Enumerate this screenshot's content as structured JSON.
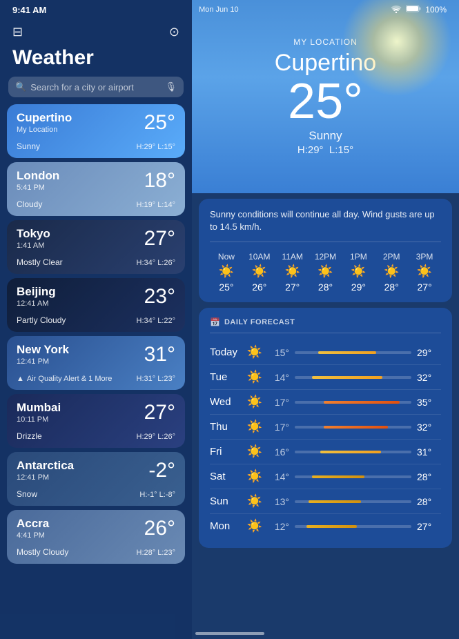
{
  "statusBar": {
    "time": "9:41 AM",
    "date": "Mon Jun 10",
    "wifi": "100%"
  },
  "leftPanel": {
    "title": "Weather",
    "search": {
      "placeholder": "Search for a city or airport"
    },
    "cities": [
      {
        "name": "Cupertino",
        "sublabel": "My Location",
        "time": "",
        "temp": "25°",
        "condition": "Sunny",
        "high": "H:29°",
        "low": "L:15°",
        "style": "sunny",
        "alert": false
      },
      {
        "name": "London",
        "sublabel": "",
        "time": "5:41 PM",
        "temp": "18°",
        "condition": "Cloudy",
        "high": "H:19°",
        "low": "L:14°",
        "style": "cloudy",
        "alert": false
      },
      {
        "name": "Tokyo",
        "sublabel": "",
        "time": "1:41 AM",
        "temp": "27°",
        "condition": "Mostly Clear",
        "high": "H:34°",
        "low": "L:26°",
        "style": "night",
        "alert": false
      },
      {
        "name": "Beijing",
        "sublabel": "",
        "time": "12:41 AM",
        "temp": "23°",
        "condition": "Partly Cloudy",
        "high": "H:34°",
        "low": "L:22°",
        "style": "night2",
        "alert": false
      },
      {
        "name": "New York",
        "sublabel": "",
        "time": "12:41 PM",
        "temp": "31°",
        "condition": "Air Quality Alert & 1 More",
        "high": "H:31°",
        "low": "L:23°",
        "style": "alert",
        "alert": true
      },
      {
        "name": "Mumbai",
        "sublabel": "",
        "time": "10:11 PM",
        "temp": "27°",
        "condition": "Drizzle",
        "high": "H:29°",
        "low": "L:26°",
        "style": "rain",
        "alert": false
      },
      {
        "name": "Antarctica",
        "sublabel": "",
        "time": "12:41 PM",
        "temp": "-2°",
        "condition": "Snow",
        "high": "H:-1°",
        "low": "L:-8°",
        "style": "snow",
        "alert": false
      },
      {
        "name": "Accra",
        "sublabel": "",
        "time": "4:41 PM",
        "temp": "26°",
        "condition": "Mostly Cloudy",
        "high": "H:28°",
        "low": "L:23°",
        "style": "cloudy2",
        "alert": false
      }
    ]
  },
  "rightPanel": {
    "hero": {
      "myLocationLabel": "MY LOCATION",
      "city": "Cupertino",
      "temp": "25°",
      "condition": "Sunny",
      "high": "H:29°",
      "low": "L:15°"
    },
    "forecastDescription": "Sunny conditions will continue all day. Wind gusts are up to 14.5 km/h.",
    "hourly": [
      {
        "label": "Now",
        "icon": "☀️",
        "temp": "25°"
      },
      {
        "label": "10AM",
        "icon": "☀️",
        "temp": "26°"
      },
      {
        "label": "11AM",
        "icon": "☀️",
        "temp": "27°"
      },
      {
        "label": "12PM",
        "icon": "☀️",
        "temp": "28°"
      },
      {
        "label": "1PM",
        "icon": "☀️",
        "temp": "29°"
      },
      {
        "label": "2PM",
        "icon": "☀️",
        "temp": "28°"
      },
      {
        "label": "3PM",
        "icon": "☀️",
        "temp": "27°"
      }
    ],
    "dailyHeader": "DAILY FORECAST",
    "daily": [
      {
        "day": "Today",
        "icon": "☀️",
        "low": "15°",
        "high": "29°",
        "barLeft": "20%",
        "barWidth": "50%",
        "barClass": "bar-yellow"
      },
      {
        "day": "Tue",
        "icon": "☀️",
        "low": "14°",
        "high": "32°",
        "barLeft": "15%",
        "barWidth": "60%",
        "barClass": "bar-yellow"
      },
      {
        "day": "Wed",
        "icon": "☀️",
        "low": "17°",
        "high": "35°",
        "barLeft": "25%",
        "barWidth": "65%",
        "barClass": "bar-orange"
      },
      {
        "day": "Thu",
        "icon": "☀️",
        "low": "17°",
        "high": "32°",
        "barLeft": "25%",
        "barWidth": "55%",
        "barClass": "bar-orange"
      },
      {
        "day": "Fri",
        "icon": "☀️",
        "low": "16°",
        "high": "31°",
        "barLeft": "22%",
        "barWidth": "52%",
        "barClass": "bar-yellow"
      },
      {
        "day": "Sat",
        "icon": "☀️",
        "low": "14°",
        "high": "28°",
        "barLeft": "15%",
        "barWidth": "45%",
        "barClass": "bar-gold"
      },
      {
        "day": "Sun",
        "icon": "☀️",
        "low": "13°",
        "high": "28°",
        "barLeft": "12%",
        "barWidth": "45%",
        "barClass": "bar-gold"
      },
      {
        "day": "Mon",
        "icon": "☀️",
        "low": "12°",
        "high": "27°",
        "barLeft": "10%",
        "barWidth": "43%",
        "barClass": "bar-gold"
      }
    ]
  }
}
